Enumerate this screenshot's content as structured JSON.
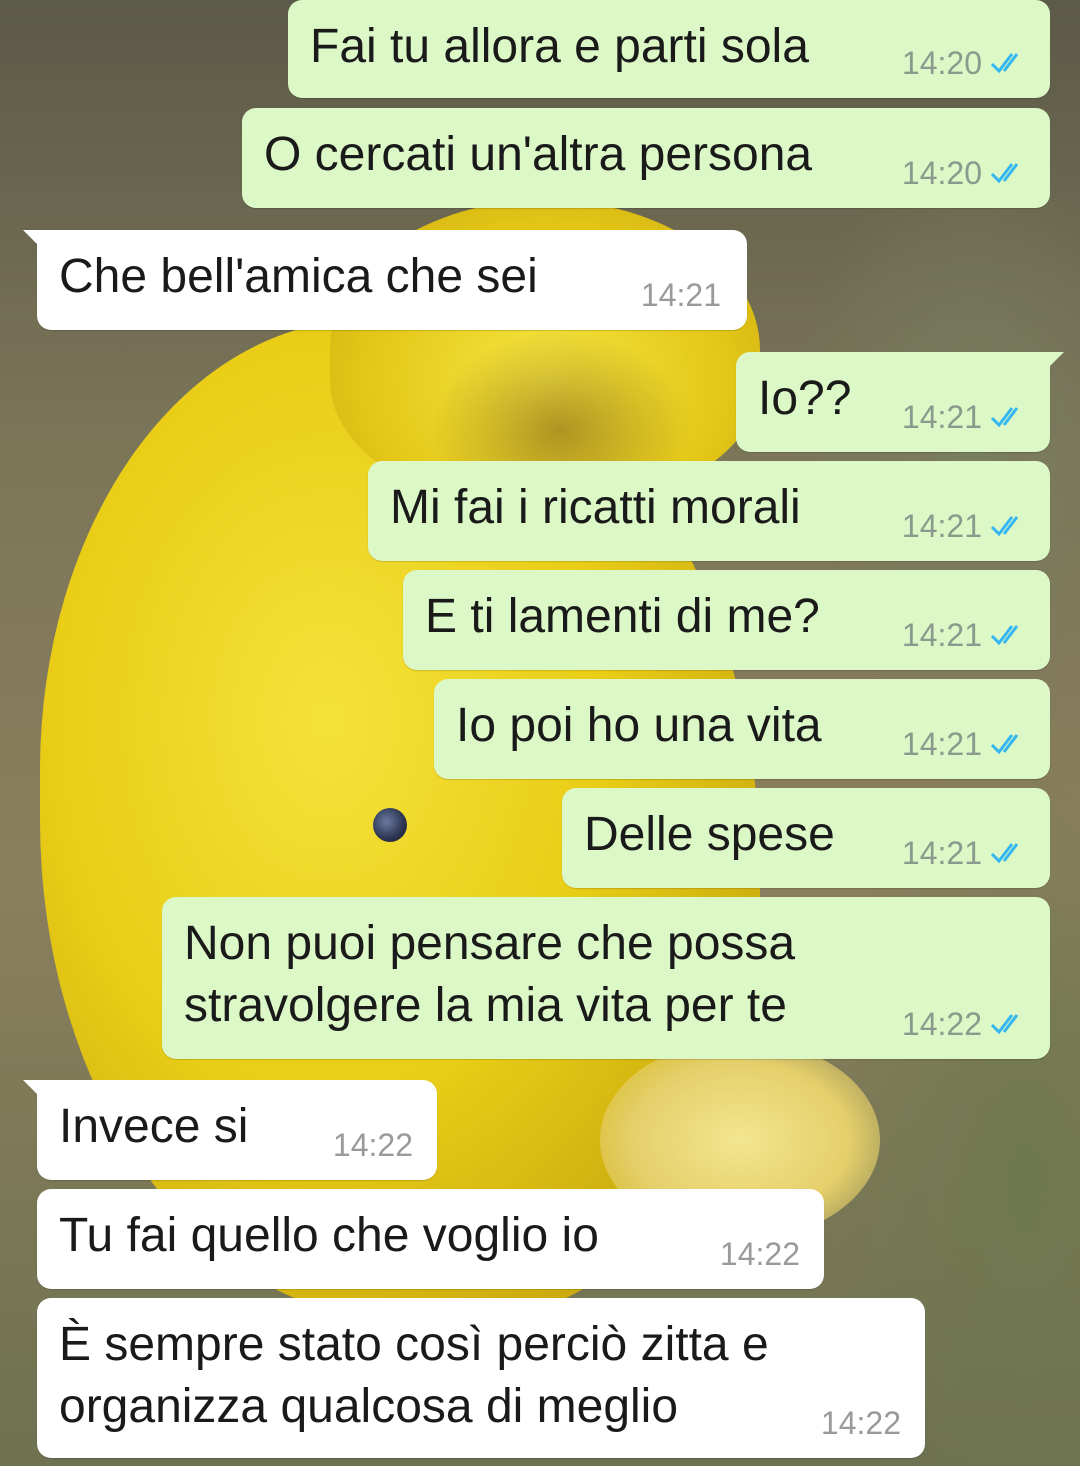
{
  "colors": {
    "outgoing_bubble": "#dcf8c6",
    "incoming_bubble": "#ffffff",
    "read_ticks": "#34b7f1"
  },
  "messages": [
    {
      "direction": "out",
      "text": "Fai tu allora e parti sola",
      "time": "14:20",
      "status": "read"
    },
    {
      "direction": "out",
      "text": "O cercati un'altra persona",
      "time": "14:20",
      "status": "read"
    },
    {
      "direction": "in",
      "text": "Che bell'amica che sei",
      "time": "14:21"
    },
    {
      "direction": "out",
      "text": "Io??",
      "time": "14:21",
      "status": "read"
    },
    {
      "direction": "out",
      "text": "Mi fai i ricatti morali",
      "time": "14:21",
      "status": "read"
    },
    {
      "direction": "out",
      "text": "E ti lamenti di me?",
      "time": "14:21",
      "status": "read"
    },
    {
      "direction": "out",
      "text": "Io poi ho una vita",
      "time": "14:21",
      "status": "read"
    },
    {
      "direction": "out",
      "text": "Delle spese",
      "time": "14:21",
      "status": "read"
    },
    {
      "direction": "out",
      "text": "Non puoi pensare che possa\nstravolgere la mia vita per te",
      "time": "14:22",
      "status": "read"
    },
    {
      "direction": "in",
      "text": "Invece si",
      "time": "14:22"
    },
    {
      "direction": "in",
      "text": "Tu fai quello che voglio io",
      "time": "14:22"
    },
    {
      "direction": "in",
      "text": "È sempre stato così perciò zitta e\norganizza qualcosa di meglio",
      "time": "14:22"
    }
  ]
}
